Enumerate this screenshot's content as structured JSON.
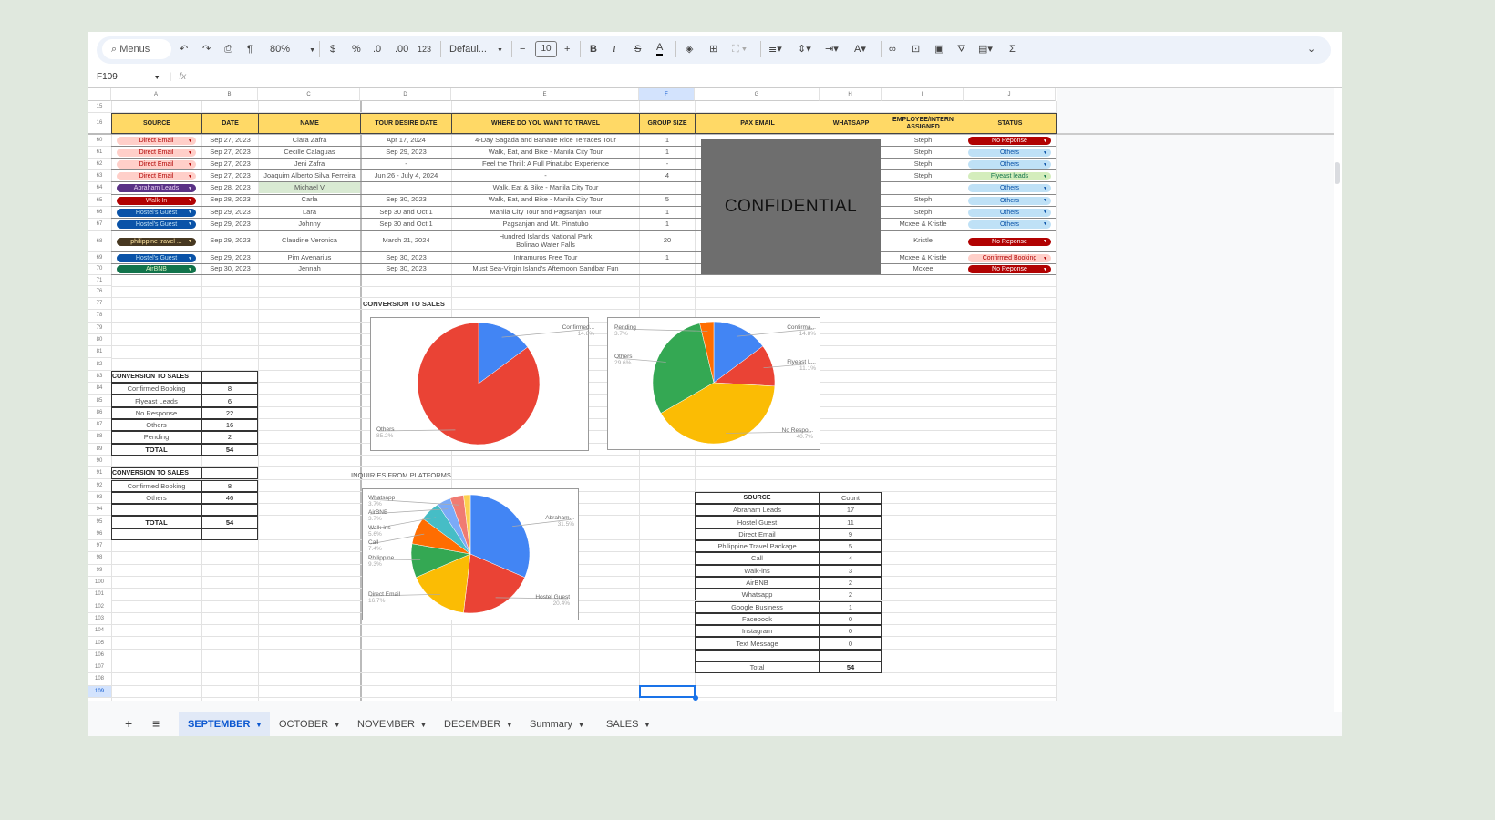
{
  "toolbar": {
    "menus_label": "Menus",
    "zoom": "80%",
    "currency": "$",
    "percent": "%",
    "decrease_decimal": ".0",
    "increase_decimal": ".00",
    "number_format": "123",
    "font": "Defaul...",
    "font_size": "10",
    "icons": [
      "search-icon",
      "undo-icon",
      "redo-icon",
      "print-icon",
      "paint-format-icon",
      "bold-icon",
      "italic-icon",
      "strikethrough-icon",
      "text-color-icon",
      "fill-color-icon",
      "borders-icon",
      "merge-icon",
      "align-icon",
      "valign-icon",
      "wrap-icon",
      "rotate-icon",
      "link-icon",
      "comment-icon",
      "chart-icon",
      "filter-icon",
      "views-icon",
      "functions-icon",
      "collapse-icon"
    ]
  },
  "formula_bar": {
    "name_box": "F109",
    "fx": "fx",
    "value": ""
  },
  "columns": [
    "A",
    "B",
    "C",
    "D",
    "E",
    "F",
    "G",
    "H",
    "I",
    "J"
  ],
  "selected_column": "F",
  "row_numbers": [
    "15",
    "16",
    "60",
    "61",
    "62",
    "63",
    "64",
    "65",
    "66",
    "67",
    "68",
    "69",
    "70",
    "71",
    "76",
    "77",
    "78",
    "79",
    "80",
    "81",
    "82",
    "83",
    "84",
    "85",
    "86",
    "87",
    "88",
    "89",
    "90",
    "91",
    "92",
    "93",
    "94",
    "95",
    "96",
    "97",
    "98",
    "99",
    "100",
    "101",
    "102",
    "103",
    "104",
    "105",
    "106",
    "107",
    "108",
    "109"
  ],
  "selected_row": "109",
  "headers": [
    "SOURCE",
    "DATE",
    "NAME",
    "TOUR DESIRE DATE",
    "WHERE DO YOU WANT TO TRAVEL",
    "GROUP SIZE",
    "PAX EMAIL",
    "WHATSAPP",
    "EMPLOYEE/INTERN ASSIGNED",
    "STATUS"
  ],
  "rows": [
    {
      "source": "Direct Email",
      "source_bg": "#ffcfc9",
      "source_fg": "#b10202",
      "date": "Sep 27, 2023",
      "name": "Clara Zafra",
      "tour_date": "Apr 17, 2024",
      "destination": "4-Day Sagada and Banaue Rice Terraces Tour",
      "group_size": "1",
      "employee": "Steph",
      "status": "No Reponse",
      "status_bg": "#b10202",
      "status_fg": "#ffffff"
    },
    {
      "source": "Direct Email",
      "source_bg": "#ffcfc9",
      "source_fg": "#b10202",
      "date": "Sep 27, 2023",
      "name": "Cecille Calaguas",
      "tour_date": "Sep 29, 2023",
      "destination": "Walk, Eat, and Bike - Manila City Tour",
      "group_size": "1",
      "employee": "Steph",
      "status": "Others",
      "status_bg": "#bfe1f6",
      "status_fg": "#0a53a8"
    },
    {
      "source": "Direct Email",
      "source_bg": "#ffcfc9",
      "source_fg": "#b10202",
      "date": "Sep 27, 2023",
      "name": "Jeni Zafra",
      "tour_date": "-",
      "destination": "Feel the Thrill: A Full Pinatubo Experience",
      "group_size": "-",
      "employee": "Steph",
      "status": "Others",
      "status_bg": "#bfe1f6",
      "status_fg": "#0a53a8"
    },
    {
      "source": "Direct Email",
      "source_bg": "#ffcfc9",
      "source_fg": "#b10202",
      "date": "Sep 27, 2023",
      "name": "Joaquim Alberto Silva Ferreira",
      "tour_date": "Jun 26 - July 4, 2024",
      "destination": "-",
      "group_size": "4",
      "employee": "Steph",
      "status": "Flyeast leads",
      "status_bg": "#d4edbc",
      "status_fg": "#11734b"
    },
    {
      "source": "Abraham Leads",
      "source_bg": "#5a3286",
      "source_fg": "#e6cff2",
      "date": "Sep 28, 2023",
      "name": "Michael V",
      "name_bg": "#d9ead3",
      "tour_date": "",
      "destination": "Walk, Eat & Bike - Manila City Tour",
      "group_size": "",
      "employee": "",
      "status": "Others",
      "status_bg": "#bfe1f6",
      "status_fg": "#0a53a8"
    },
    {
      "source": "Walk-In",
      "source_bg": "#b10202",
      "source_fg": "#ffcfc9",
      "date": "Sep 28, 2023",
      "name": "Carla",
      "tour_date": "Sep 30, 2023",
      "destination": "Walk, Eat, and Bike - Manila City Tour",
      "group_size": "5",
      "employee": "Steph",
      "status": "Others",
      "status_bg": "#bfe1f6",
      "status_fg": "#0a53a8"
    },
    {
      "source": "Hostel's Guest",
      "source_bg": "#0a53a8",
      "source_fg": "#bfe1f6",
      "date": "Sep 29, 2023",
      "name": "Lara",
      "tour_date": "Sep 30 and Oct 1",
      "destination": "Manila City Tour and Pagsanjan Tour",
      "group_size": "1",
      "employee": "Steph",
      "status": "Others",
      "status_bg": "#bfe1f6",
      "status_fg": "#0a53a8"
    },
    {
      "source": "Hostel's Guest",
      "source_bg": "#0a53a8",
      "source_fg": "#bfe1f6",
      "date": "Sep 29, 2023",
      "name": "Johnny",
      "tour_date": "Sep 30 and Oct 1",
      "destination": "Pagsanjan and Mt. Pinatubo",
      "group_size": "1",
      "employee": "Mcxee & Kristle",
      "status": "Others",
      "status_bg": "#bfe1f6",
      "status_fg": "#0a53a8"
    },
    {
      "source": "philippine travel ...",
      "source_bg": "#473821",
      "source_fg": "#ffe5a0",
      "date": "Sep 29, 2023",
      "name": "Claudine Veronica",
      "tour_date": "March 21, 2024",
      "destination": "Hundred Islands National Park\nBolinao Water Falls",
      "group_size": "20",
      "employee": "Kristle",
      "status": "No Reponse",
      "status_bg": "#b10202",
      "status_fg": "#ffffff"
    },
    {
      "source": "Hostel's Guest",
      "source_bg": "#0a53a8",
      "source_fg": "#bfe1f6",
      "date": "Sep 29, 2023",
      "name": "Pim Avenarius",
      "tour_date": "Sep 30, 2023",
      "destination": "Intramuros Free Tour",
      "group_size": "1",
      "employee": "Mcxee & Kristle",
      "status": "Confirmed Booking",
      "status_bg": "#ffcfc9",
      "status_fg": "#b10202"
    },
    {
      "source": "AirBNB",
      "source_bg": "#11734b",
      "source_fg": "#d4edbc",
      "date": "Sep 30, 2023",
      "name": "Jennah",
      "tour_date": "Sep 30, 2023",
      "destination": "Must Sea-Virgin Island's Afternoon Sandbar Fun",
      "group_size": "",
      "employee": "Mcxee",
      "status": "No Reponse",
      "status_bg": "#b10202",
      "status_fg": "#ffffff"
    }
  ],
  "confidential_label": "CONFIDENTIAL",
  "conversion_table": {
    "title": "CONVERSION TO SALES",
    "rows": [
      {
        "label": "Confirmed Booking",
        "value": "8"
      },
      {
        "label": "Flyeast Leads",
        "value": "6"
      },
      {
        "label": "No Response",
        "value": "22"
      },
      {
        "label": "Others",
        "value": "16"
      },
      {
        "label": "Pending",
        "value": "2"
      }
    ],
    "total_label": "TOTAL",
    "total": "54"
  },
  "conversion_table_2": {
    "title": "CONVERSION TO SALES",
    "rows": [
      {
        "label": "Confirmed Booking",
        "value": "8"
      },
      {
        "label": "Others",
        "value": "46"
      }
    ],
    "total_label": "TOTAL",
    "total": "54"
  },
  "source_table": {
    "headers": [
      "SOURCE",
      "Count"
    ],
    "rows": [
      {
        "label": "Abraham Leads",
        "value": "17"
      },
      {
        "label": "Hostel Guest",
        "value": "11"
      },
      {
        "label": "Direct Email",
        "value": "9"
      },
      {
        "label": "Philippine Travel Package",
        "value": "5"
      },
      {
        "label": "Call",
        "value": "4"
      },
      {
        "label": "Walk-ins",
        "value": "3"
      },
      {
        "label": "AirBNB",
        "value": "2"
      },
      {
        "label": "Whatsapp",
        "value": "2"
      },
      {
        "label": "Google Business",
        "value": "1"
      },
      {
        "label": "Facebook",
        "value": "0"
      },
      {
        "label": "Instagram",
        "value": "0"
      },
      {
        "label": "Text Message",
        "value": "0"
      }
    ],
    "total_label": "Total",
    "total": "54"
  },
  "chart_section_titles": {
    "conversion": "CONVERSION TO SALES",
    "platforms": "INQUIRIES FROM PLATFORMS"
  },
  "chart_data": [
    {
      "type": "pie",
      "title": "",
      "slices": [
        {
          "label": "Confirmed...",
          "pct_label": "14.8%",
          "value": 8,
          "color": "#4285f4"
        },
        {
          "label": "Others",
          "pct_label": "85.2%",
          "value": 46,
          "color": "#ea4335"
        }
      ]
    },
    {
      "type": "pie",
      "title": "",
      "slices": [
        {
          "label": "Confirma...",
          "pct_label": "14.8%",
          "value": 8,
          "color": "#4285f4"
        },
        {
          "label": "Flyeast L...",
          "pct_label": "11.1%",
          "value": 6,
          "color": "#ea4335"
        },
        {
          "label": "No Respo...",
          "pct_label": "40.7%",
          "value": 22,
          "color": "#fbbc04"
        },
        {
          "label": "Others",
          "pct_label": "29.6%",
          "value": 16,
          "color": "#34a853"
        },
        {
          "label": "Pending",
          "pct_label": "3.7%",
          "value": 2,
          "color": "#ff6d01"
        }
      ]
    },
    {
      "type": "pie",
      "title": "",
      "slices": [
        {
          "label": "Abraham...",
          "pct_label": "31.5%",
          "value": 17,
          "color": "#4285f4"
        },
        {
          "label": "Hostel Guest",
          "pct_label": "20.4%",
          "value": 11,
          "color": "#ea4335"
        },
        {
          "label": "Direct Email",
          "pct_label": "16.7%",
          "value": 9,
          "color": "#fbbc04"
        },
        {
          "label": "Philippine...",
          "pct_label": "9.3%",
          "value": 5,
          "color": "#34a853"
        },
        {
          "label": "Call",
          "pct_label": "7.4%",
          "value": 4,
          "color": "#ff6d01"
        },
        {
          "label": "Walk-ins",
          "pct_label": "5.6%",
          "value": 3,
          "color": "#46bdc6"
        },
        {
          "label": "AirBNB",
          "pct_label": "3.7%",
          "value": 2,
          "color": "#7baaf7"
        },
        {
          "label": "Whatsapp",
          "pct_label": "3.7%",
          "value": 2,
          "color": "#f07b72"
        },
        {
          "label": "Google Business",
          "pct_label": "",
          "value": 1,
          "color": "#fcd04f"
        }
      ]
    }
  ],
  "sheet_tabs": [
    {
      "label": "SEPTEMBER",
      "active": true
    },
    {
      "label": "OCTOBER"
    },
    {
      "label": "NOVEMBER"
    },
    {
      "label": "DECEMBER"
    },
    {
      "label": "Summary"
    },
    {
      "label": "SALES"
    }
  ],
  "tab_controls": {
    "add": "+",
    "all_sheets": "≡"
  }
}
